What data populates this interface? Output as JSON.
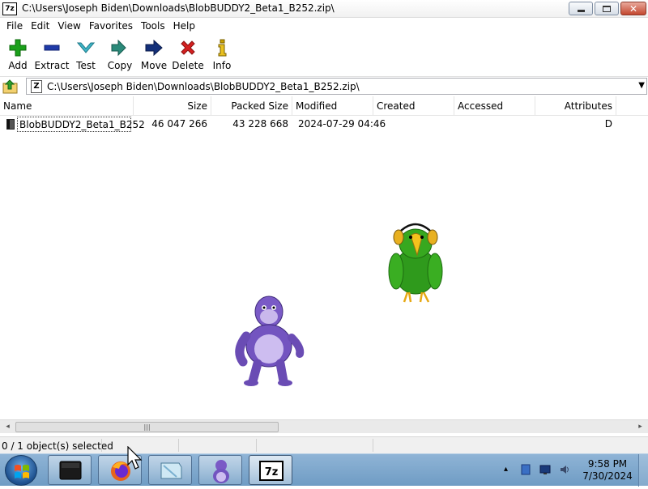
{
  "window": {
    "title": "C:\\Users\\Joseph Biden\\Downloads\\BlobBUDDY2_Beta1_B252.zip\\",
    "app_logo": "7z",
    "controls": {
      "minimize": "minimize-icon",
      "maximize": "maximize-icon",
      "close": "close-icon"
    }
  },
  "menu": [
    "File",
    "Edit",
    "View",
    "Favorites",
    "Tools",
    "Help"
  ],
  "toolbar": [
    {
      "label": "Add",
      "icon": "plus-icon",
      "color": "#1aa01a"
    },
    {
      "label": "Extract",
      "icon": "minus-icon",
      "color": "#1f3aa8"
    },
    {
      "label": "Test",
      "icon": "check-chevron-icon",
      "color": "#3fb6c8"
    },
    {
      "label": "Copy",
      "icon": "double-arrow-icon",
      "color": "#2b8a7a"
    },
    {
      "label": "Move",
      "icon": "arrow-right-icon",
      "color": "#14307a"
    },
    {
      "label": "Delete",
      "icon": "x-icon",
      "color": "#d42020"
    },
    {
      "label": "Info",
      "icon": "info-icon",
      "color": "#c8a000"
    }
  ],
  "address": {
    "path": "C:\\Users\\Joseph Biden\\Downloads\\BlobBUDDY2_Beta1_B252.zip\\",
    "icon_text": "Z"
  },
  "columns": [
    "Name",
    "Size",
    "Packed Size",
    "Modified",
    "Created",
    "Accessed",
    "Attributes"
  ],
  "rows": [
    {
      "name": "BlobBUDDY2_Beta1_B252",
      "size": "46 047 266",
      "packed_size": "43 228 668",
      "modified": "2024-07-29 04:46",
      "created": "",
      "accessed": "",
      "attributes": "D"
    }
  ],
  "scrollbar": {
    "left_arrow": "◂",
    "right_arrow": "▸",
    "grip": "|||"
  },
  "status": {
    "text": "0 / 1 object(s) selected"
  },
  "taskbar": {
    "items": [
      "start-orb",
      "terminal-app",
      "firefox-app",
      "screenshot-app",
      "bonzibuddy-app",
      "7zip-app"
    ],
    "active_item": "7zip-app",
    "tray_arrow": "▴",
    "clock_time": "9:58 PM",
    "clock_date": "7/30/2024"
  }
}
